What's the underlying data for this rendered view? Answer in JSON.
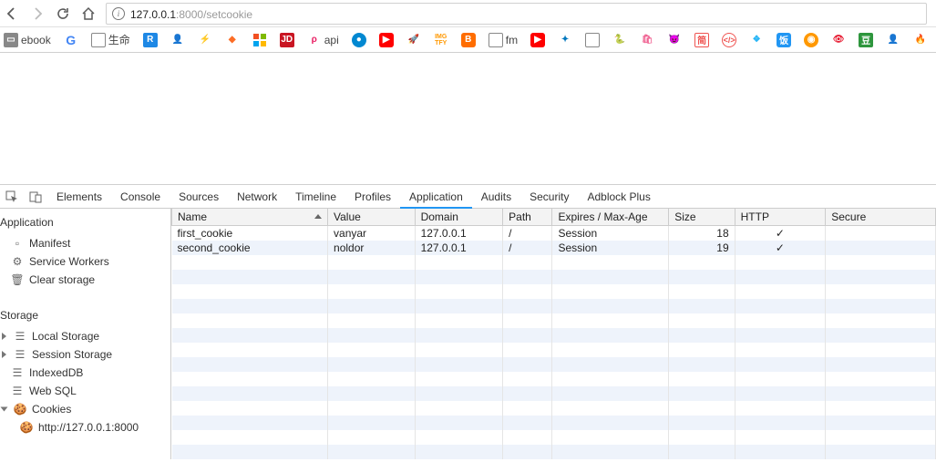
{
  "addressbar": {
    "url_host": "127.0.0.1",
    "url_port": ":8000",
    "url_path": "/setcookie"
  },
  "bookmarks": {
    "items": [
      "ebook",
      "",
      "生命",
      "",
      "",
      "",
      "",
      "",
      "JD",
      "api",
      "",
      "",
      "",
      "",
      "",
      "fm",
      "",
      "",
      "",
      "",
      "",
      "",
      "",
      "",
      "",
      "",
      "",
      "",
      "",
      "",
      "",
      "",
      "",
      ""
    ]
  },
  "devtools": {
    "tabs": [
      "Elements",
      "Console",
      "Sources",
      "Network",
      "Timeline",
      "Profiles",
      "Application",
      "Audits",
      "Security",
      "Adblock Plus"
    ],
    "active_tab": "Application",
    "sidebar": {
      "section1": "Application",
      "items1": [
        "Manifest",
        "Service Workers",
        "Clear storage"
      ],
      "section2": "Storage",
      "items2": [
        "Local Storage",
        "Session Storage",
        "IndexedDB",
        "Web SQL",
        "Cookies"
      ],
      "cookie_origin": "http://127.0.0.1:8000"
    },
    "table": {
      "headers": [
        "Name",
        "Value",
        "Domain",
        "Path",
        "Expires / Max-Age",
        "Size",
        "HTTP",
        "Secure"
      ],
      "rows": [
        {
          "name": "first_cookie",
          "value": "vanyar",
          "domain": "127.0.0.1",
          "path": "/",
          "expires": "Session",
          "size": "18",
          "http": "✓",
          "secure": ""
        },
        {
          "name": "second_cookie",
          "value": "noldor",
          "domain": "127.0.0.1",
          "path": "/",
          "expires": "Session",
          "size": "19",
          "http": "✓",
          "secure": ""
        }
      ]
    }
  }
}
